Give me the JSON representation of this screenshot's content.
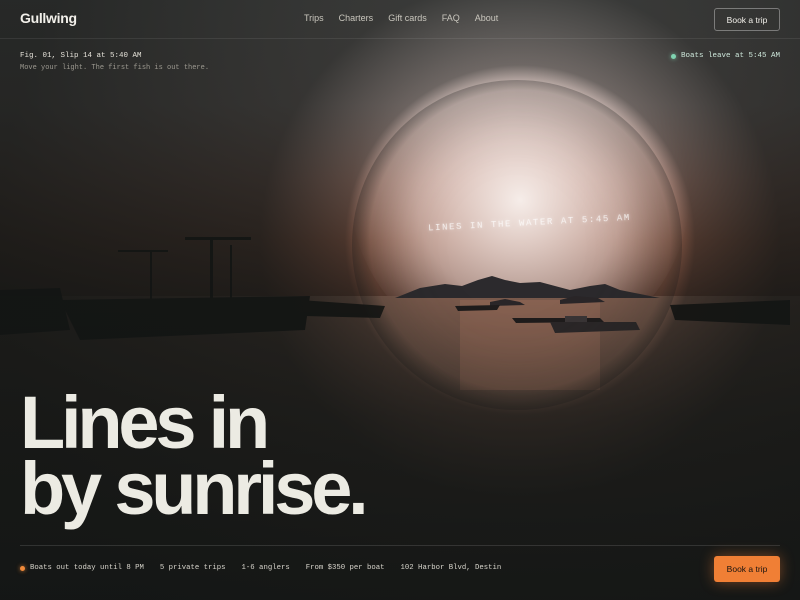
{
  "nav": {
    "logo": "Gullwing",
    "links": [
      "Trips",
      "Charters",
      "Gift cards",
      "FAQ",
      "About"
    ],
    "cta": "Book a trip"
  },
  "hero": {
    "caption": "Fig. 01, Slip 14 at 5:40 AM",
    "subcaption": "Move your light. The first fish is out there.",
    "status": "Boats leave at 5:45 AM",
    "spotlight_text": "LINES IN THE WATER AT 5:45 AM",
    "headline_line1": "Lines in",
    "headline_line2": "by sunrise."
  },
  "footer": {
    "stats": [
      "Boats out today until 8 PM",
      "5 private trips",
      "1-6 anglers",
      "From $350 per boat",
      "102 Harbor Blvd, Destin"
    ],
    "cta": "Book a trip"
  },
  "colors": {
    "accent": "#f07f35",
    "status_green": "#7fd3b0",
    "background": "#171b19"
  }
}
